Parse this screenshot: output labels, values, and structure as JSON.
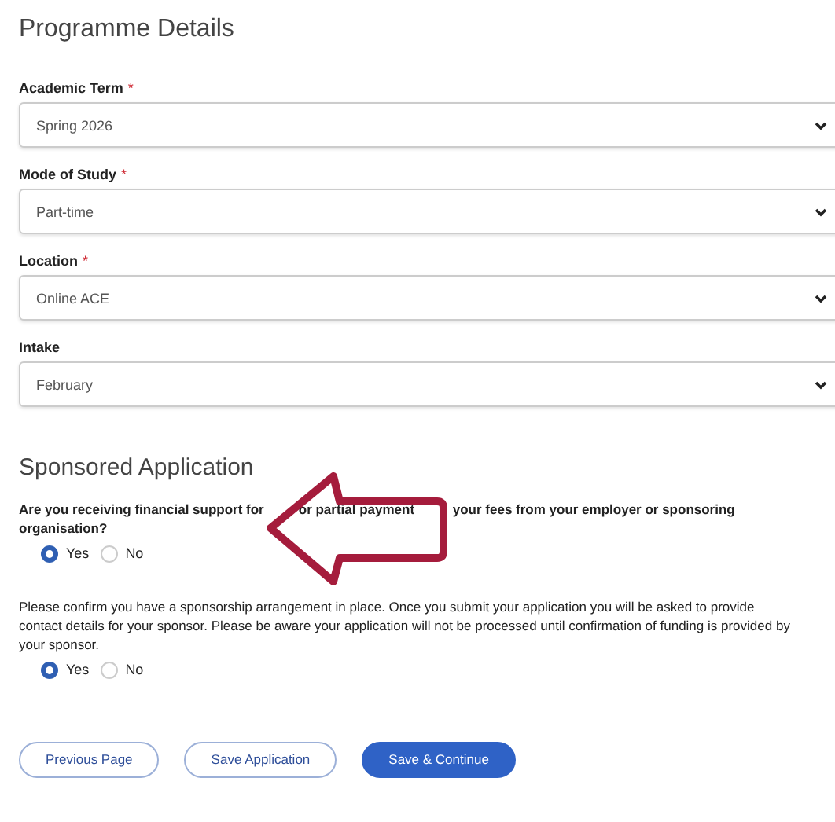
{
  "programme_details": {
    "title": "Programme Details",
    "fields": [
      {
        "label": "Academic Term",
        "required_mark": "*",
        "value": "Spring 2026"
      },
      {
        "label": "Mode of Study",
        "required_mark": "*",
        "value": "Part-time"
      },
      {
        "label": "Location",
        "required_mark": "*",
        "value": "Online ACE"
      },
      {
        "label": "Intake",
        "value": "February"
      }
    ]
  },
  "sponsored_application": {
    "title": "Sponsored Application",
    "questions": [
      {
        "segments": [
          "Are you receiving financial support for",
          "or partial payment",
          "your fees from your employer or sponsoring",
          "organisation?"
        ],
        "options": [
          {
            "label": "Yes",
            "selected": true
          },
          {
            "label": "No",
            "selected": false
          }
        ]
      },
      {
        "text": "Please confirm you have a sponsorship arrangement in place. Once you submit your application you will be asked to provide contact details for your sponsor. Please be aware your application will not be processed until confirmation of funding is provided by your sponsor.",
        "options": [
          {
            "label": "Yes",
            "selected": true
          },
          {
            "label": "No",
            "selected": false
          }
        ]
      }
    ]
  },
  "buttons": [
    {
      "label": "Previous Page",
      "kind": "outline"
    },
    {
      "label": "Save Application",
      "kind": "outline"
    },
    {
      "label": "Save & Continue",
      "kind": "primary"
    }
  ]
}
